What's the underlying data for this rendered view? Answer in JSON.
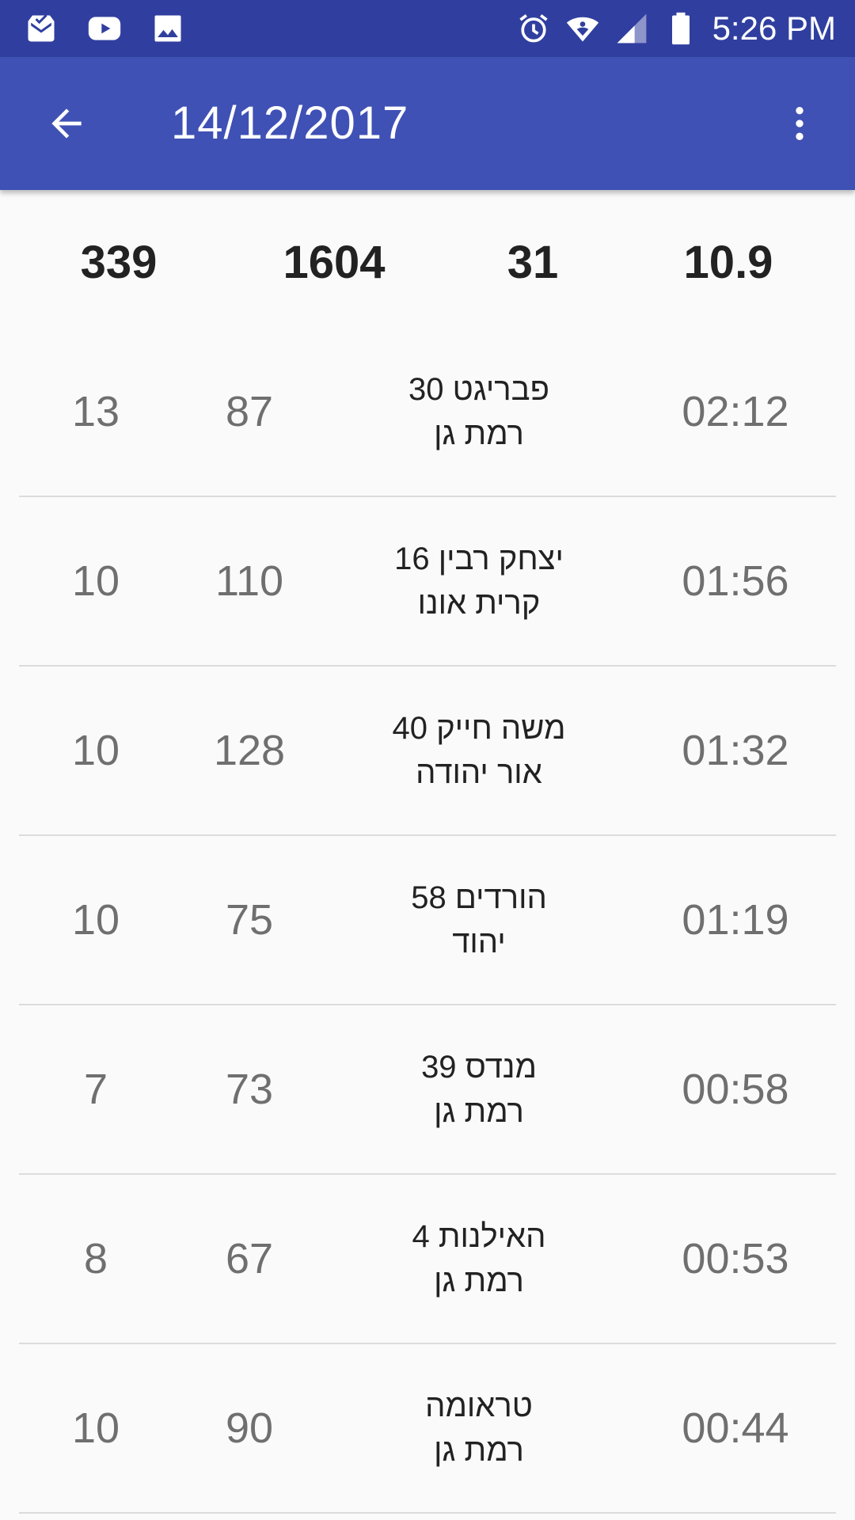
{
  "status_bar": {
    "time": "5:26 PM",
    "left_icons": [
      "inbox-icon",
      "youtube-icon",
      "image-icon"
    ],
    "right_icons": [
      "alarm-icon",
      "wifi-icon",
      "signal-icon",
      "battery-icon"
    ]
  },
  "app_bar": {
    "title": "14/12/2017",
    "back_icon": "arrow-back-icon",
    "menu_icon": "more-vert-icon"
  },
  "summary": {
    "col1": "339",
    "col2": "1604",
    "col3": "31",
    "col4": "10.9"
  },
  "rows": [
    {
      "col1": "13",
      "col2": "87",
      "street": "פבריגט 30",
      "city": "רמת גן",
      "time": "02:12"
    },
    {
      "col1": "10",
      "col2": "110",
      "street": "יצחק רבין 16",
      "city": "קרית אונו",
      "time": "01:56"
    },
    {
      "col1": "10",
      "col2": "128",
      "street": "משה חייק 40",
      "city": "אור יהודה",
      "time": "01:32"
    },
    {
      "col1": "10",
      "col2": "75",
      "street": "הורדים 58",
      "city": "יהוד",
      "time": "01:19"
    },
    {
      "col1": "7",
      "col2": "73",
      "street": "מנדס 39",
      "city": "רמת גן",
      "time": "00:58"
    },
    {
      "col1": "8",
      "col2": "67",
      "street": "האילנות 4",
      "city": "רמת גן",
      "time": "00:53"
    },
    {
      "col1": "10",
      "col2": "90",
      "street": "טראומה",
      "city": "רמת גן",
      "time": "00:44"
    }
  ],
  "colors": {
    "status_bar": "#303f9f",
    "app_bar": "#3f51b5",
    "background": "#fafafa"
  }
}
